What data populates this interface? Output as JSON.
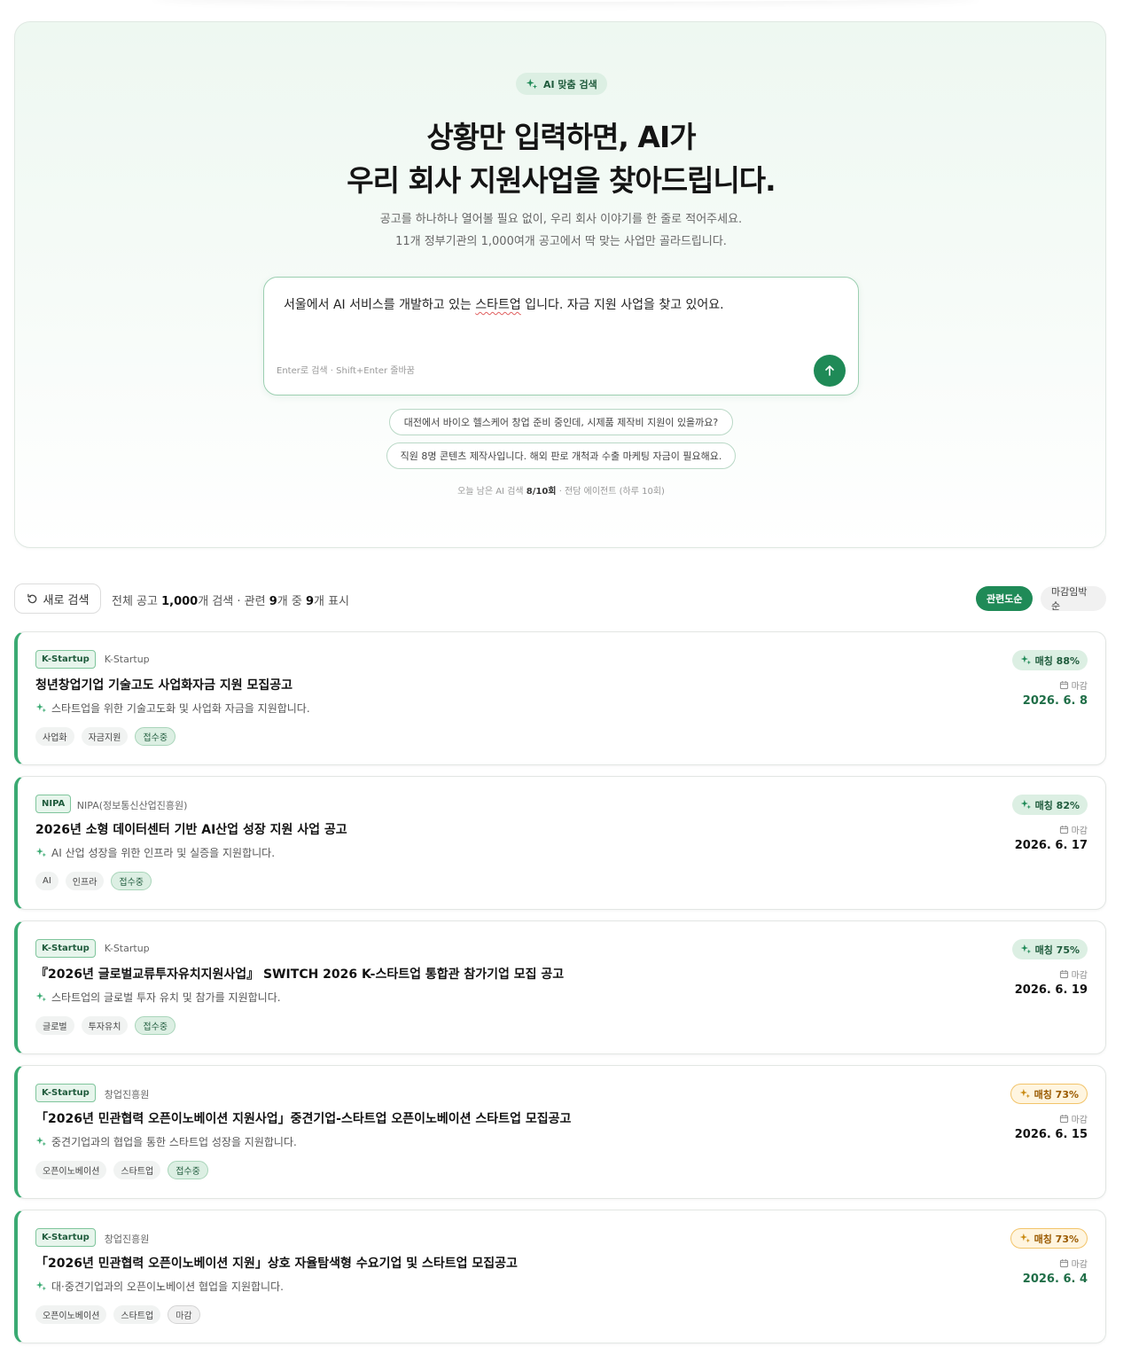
{
  "hero": {
    "badge": "AI 맞춤 검색",
    "title_line1": "상황만 입력하면, AI가",
    "title_line2": "우리 회사 지원사업을 찾아드립니다.",
    "sub_line1": "공고를 하나하나 열어볼 필요 없이, 우리 회사 이야기를 한 줄로 적어주세요.",
    "sub_line2": "11개 정부기관의 1,000여개 공고에서 딱 맞는 사업만 골라드립니다."
  },
  "search": {
    "value_before": "서울에서 AI 서비스를 개발하고 있는 ",
    "value_misspelled": "스타트업",
    "value_after": " 입니다. 자금 지원 사업을 찾고 있어요.",
    "hint": "Enter로 검색 · Shift+Enter 줄바꿈",
    "send_icon": "arrow-up-icon"
  },
  "examples": [
    "대전에서 바이오 헬스케어 창업 준비 중인데, 시제품 제작비 지원이 있을까요?",
    "직원 8명 콘텐츠 제작사입니다. 해외 판로 개척과 수출 마케팅 자금이 필요해요."
  ],
  "quota": {
    "prefix": "오늘 남은 AI 검색 ",
    "count": "8/10회",
    "suffix": " · 전담 에이전트 (하루 10회)"
  },
  "toolbar": {
    "reset_label": "새로 검색",
    "summary_a": "전체 공고 ",
    "total": "1,000",
    "summary_b": "개 검색 · 관련 ",
    "related": "9",
    "summary_c": "개 중 ",
    "shown": "9",
    "summary_d": "개 표시",
    "sort_relevance": "관련도순",
    "sort_deadline": "마감임박순"
  },
  "deadline_label": "마감",
  "colors": {
    "accent": "#1f8a57",
    "accent_light": "#dcefe3",
    "amber": "#9a5a00"
  },
  "results": [
    {
      "source_tag": "K-Startup",
      "source_name": "K-Startup",
      "title": "청년창업기업 기술고도 사업화자금 지원 모집공고",
      "desc": "스타트업을 위한 기술고도화 및 사업화 자금을 지원합니다.",
      "tags": [
        "사업화",
        "자금지원"
      ],
      "status": "접수중",
      "match": "매칭 88%",
      "match_level": "green",
      "deadline": "2026. 6. 8",
      "deadline_style": "green"
    },
    {
      "source_tag": "NIPA",
      "source_name": "NIPA(정보통신산업진흥원)",
      "title": "2026년 소형 데이터센터 기반 AI산업 성장 지원 사업 공고",
      "desc": "AI 산업 성장을 위한 인프라 및 실증을 지원합니다.",
      "tags": [
        "AI",
        "인프라"
      ],
      "status": "접수중",
      "match": "매칭 82%",
      "match_level": "green",
      "deadline": "2026. 6. 17",
      "deadline_style": "dark"
    },
    {
      "source_tag": "K-Startup",
      "source_name": "K-Startup",
      "title": "『2026년 글로벌교류투자유치지원사업』 SWITCH 2026 K-스타트업 통합관 참가기업 모집 공고",
      "desc": "스타트업의 글로벌 투자 유치 및 참가를 지원합니다.",
      "tags": [
        "글로벌",
        "투자유치"
      ],
      "status": "접수중",
      "match": "매칭 75%",
      "match_level": "green",
      "deadline": "2026. 6. 19",
      "deadline_style": "dark"
    },
    {
      "source_tag": "K-Startup",
      "source_name": "창업진흥원",
      "title": "「2026년 민관협력 오픈이노베이션 지원사업」중견기업-스타트업 오픈이노베이션 스타트업 모집공고",
      "desc": "중견기업과의 협업을 통한 스타트업 성장을 지원합니다.",
      "tags": [
        "오픈이노베이션",
        "스타트업"
      ],
      "status": "접수중",
      "match": "매칭 73%",
      "match_level": "amber",
      "deadline": "2026. 6. 15",
      "deadline_style": "dark"
    },
    {
      "source_tag": "K-Startup",
      "source_name": "창업진흥원",
      "title": "「2026년 민관협력 오픈이노베이션 지원」상호 자율탐색형 수요기업 및 스타트업 모집공고",
      "desc": "대·중견기업과의 오픈이노베이션 협업을 지원합니다.",
      "tags": [
        "오픈이노베이션",
        "스타트업"
      ],
      "status": "마감",
      "match": "매칭 73%",
      "match_level": "amber",
      "deadline": "2026. 6. 4",
      "deadline_style": "green"
    }
  ]
}
